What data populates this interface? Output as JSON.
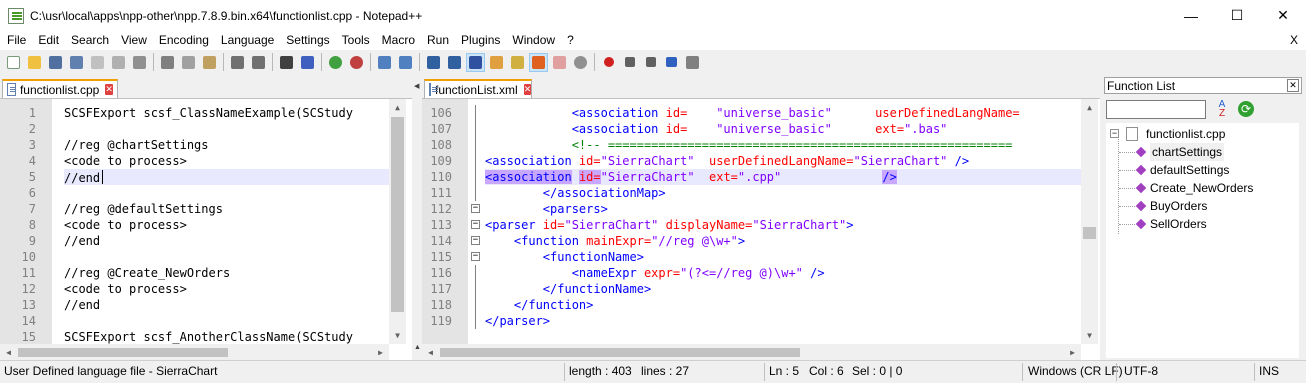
{
  "window": {
    "title": "C:\\usr\\local\\apps\\npp-other\\npp.7.8.9.bin.x64\\functionlist.cpp - Notepad++",
    "min_icon": "minimize-icon",
    "max_icon": "maximize-icon",
    "close_icon": "close-icon",
    "min_glyph": "—",
    "max_glyph": "☐",
    "close_glyph": "✕"
  },
  "menu": {
    "items": [
      "File",
      "Edit",
      "Search",
      "View",
      "Encoding",
      "Language",
      "Settings",
      "Tools",
      "Macro",
      "Run",
      "Plugins",
      "Window",
      "?"
    ],
    "close": "X"
  },
  "left_tab": {
    "label": "functionlist.cpp",
    "close": "✕"
  },
  "right_tab": {
    "label": "functionList.xml",
    "close": "✕"
  },
  "left_editor": {
    "lines": [
      {
        "n": "1",
        "text": "SCSFExport scsf_ClassNameExample(SCStudy"
      },
      {
        "n": "2",
        "text": ""
      },
      {
        "n": "3",
        "text": "//reg @chartSettings"
      },
      {
        "n": "4",
        "text": "<code to process>"
      },
      {
        "n": "5",
        "text": "//end"
      },
      {
        "n": "6",
        "text": ""
      },
      {
        "n": "7",
        "text": "//reg @defaultSettings"
      },
      {
        "n": "8",
        "text": "<code to process>"
      },
      {
        "n": "9",
        "text": "//end"
      },
      {
        "n": "10",
        "text": ""
      },
      {
        "n": "11",
        "text": "//reg @Create_NewOrders"
      },
      {
        "n": "12",
        "text": "<code to process>"
      },
      {
        "n": "13",
        "text": "//end"
      },
      {
        "n": "14",
        "text": ""
      },
      {
        "n": "15",
        "text": "SCSFExport scsf_AnotherClassName(SCStudy"
      }
    ]
  },
  "right_editor": {
    "lines": [
      {
        "n": "106",
        "indent": "            ",
        "tokens": [
          [
            "t",
            "<association "
          ],
          [
            "a",
            "id="
          ],
          [
            "v",
            "    \"universe_basic\"      "
          ],
          [
            "a",
            "userDefinedLangName="
          ]
        ]
      },
      {
        "n": "107",
        "indent": "            ",
        "tokens": [
          [
            "t",
            "<association "
          ],
          [
            "a",
            "id="
          ],
          [
            "v",
            "    \"universe_basic\"      "
          ],
          [
            "a",
            "ext="
          ],
          [
            "v",
            "\".bas\""
          ]
        ]
      },
      {
        "n": "108",
        "indent": "            ",
        "tokens": [
          [
            "c",
            "<!-- ========================================================"
          ]
        ]
      },
      {
        "n": "109",
        "indent": "",
        "tokens": [
          [
            "t",
            "<association "
          ],
          [
            "a",
            "id="
          ],
          [
            "v",
            "\"SierraChart\"  "
          ],
          [
            "a",
            "userDefinedLangName="
          ],
          [
            "v",
            "\"SierraChart\" "
          ],
          [
            "t",
            "/>"
          ]
        ]
      },
      {
        "n": "110",
        "indent": "",
        "tokens": [
          [
            "t",
            "<association"
          ],
          [
            "t",
            " "
          ],
          [
            "a",
            "id="
          ],
          [
            "v",
            "\"SierraChart\"  "
          ],
          [
            "a",
            "ext="
          ],
          [
            "v",
            "\".cpp\"              "
          ],
          [
            "t",
            "/>"
          ]
        ]
      },
      {
        "n": "111",
        "indent": "        ",
        "tokens": [
          [
            "t",
            "</associationMap>"
          ]
        ]
      },
      {
        "n": "112",
        "indent": "        ",
        "tokens": [
          [
            "t",
            "<parsers>"
          ]
        ]
      },
      {
        "n": "113",
        "indent": "",
        "tokens": [
          [
            "t",
            "<parser "
          ],
          [
            "a",
            "id="
          ],
          [
            "v",
            "\"SierraChart\" "
          ],
          [
            "a",
            "displayName="
          ],
          [
            "v",
            "\"SierraChart\""
          ],
          [
            "t",
            ">"
          ]
        ]
      },
      {
        "n": "114",
        "indent": "    ",
        "tokens": [
          [
            "t",
            "<function "
          ],
          [
            "a",
            "mainExpr="
          ],
          [
            "v",
            "\"//reg @\\w+\""
          ],
          [
            "t",
            ">"
          ]
        ]
      },
      {
        "n": "115",
        "indent": "        ",
        "tokens": [
          [
            "t",
            "<functionName>"
          ]
        ]
      },
      {
        "n": "116",
        "indent": "            ",
        "tokens": [
          [
            "t",
            "<nameExpr "
          ],
          [
            "a",
            "expr="
          ],
          [
            "v",
            "\"(?<=//reg @)\\w+\" "
          ],
          [
            "t",
            "/>"
          ]
        ]
      },
      {
        "n": "117",
        "indent": "        ",
        "tokens": [
          [
            "t",
            "</functionName>"
          ]
        ]
      },
      {
        "n": "118",
        "indent": "    ",
        "tokens": [
          [
            "t",
            "</function>"
          ]
        ]
      },
      {
        "n": "119",
        "indent": "",
        "tokens": [
          [
            "t",
            "</parser>"
          ]
        ]
      }
    ]
  },
  "function_list": {
    "title": "Function List",
    "close": "✕",
    "search_value": "",
    "root": "functionlist.cpp",
    "items": [
      "chartSettings",
      "defaultSettings",
      "Create_NewOrders",
      "BuyOrders",
      "SellOrders"
    ]
  },
  "status": {
    "language": "User Defined language file - SierraChart",
    "length": "length : 403",
    "lines": "lines : 27",
    "ln": "Ln : 5",
    "col": "Col : 6",
    "sel": "Sel : 0 | 0",
    "eol": "Windows (CR LF)",
    "encoding": "UTF-8",
    "mode": "INS"
  },
  "colors": {
    "tag": "#0000ff",
    "attr": "#ff0000",
    "value": "#8000ff",
    "comment": "#008000",
    "current_line": "#e8e8ff",
    "tab_accent": "#f0a000"
  }
}
